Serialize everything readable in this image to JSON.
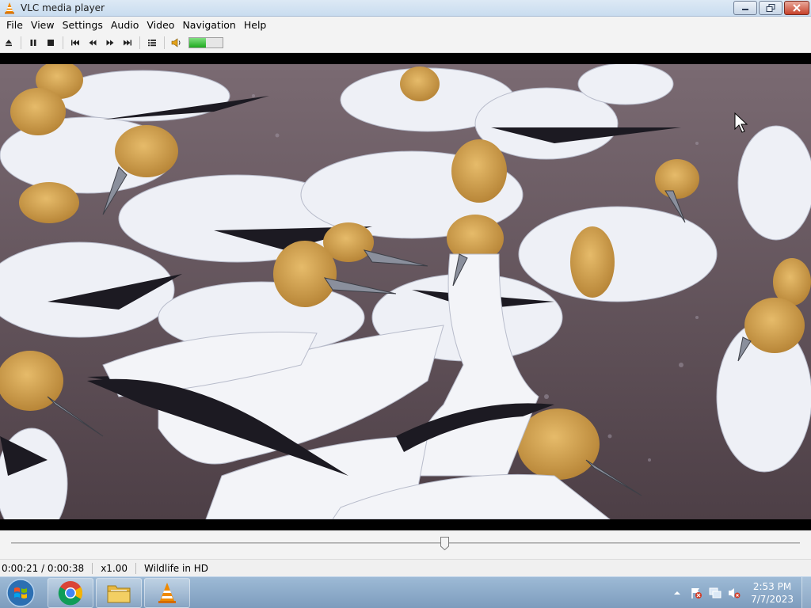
{
  "window": {
    "title": "VLC media player",
    "icon": "vlc-cone-icon",
    "controls": [
      "minimize-icon",
      "maximize-icon",
      "close-icon"
    ]
  },
  "menu": [
    {
      "label": "File"
    },
    {
      "label": "View"
    },
    {
      "label": "Settings"
    },
    {
      "label": "Audio"
    },
    {
      "label": "Video"
    },
    {
      "label": "Navigation"
    },
    {
      "label": "Help"
    }
  ],
  "toolbar": {
    "buttons": [
      "eject-icon",
      "pause-icon",
      "stop-icon",
      "skip-previous-icon",
      "rewind-icon",
      "fast-forward-icon",
      "skip-next-icon",
      "playlist-icon",
      "speaker-icon"
    ],
    "volume_level": 0.5,
    "volume_color": "#1faa1f"
  },
  "video": {
    "content": "gannets-colony-video-frame"
  },
  "seek": {
    "position_fraction": 0.55
  },
  "status": {
    "time": "0:00:21 / 0:00:38",
    "speed": "x1.00",
    "media_title": "Wildlife in HD"
  },
  "taskbar": {
    "items": [
      "windows-start-icon",
      "chrome-icon",
      "file-explorer-icon",
      "vlc-cone-icon"
    ],
    "tray_icons": [
      "show-hidden-icons-icon",
      "action-center-flag-icon",
      "network-icon",
      "volume-muted-icon"
    ],
    "clock_time": "2:53 PM",
    "clock_date": "7/7/2023"
  },
  "colors": {
    "accent_orange": "#f08a00",
    "taskbar": "#8fadcb"
  }
}
